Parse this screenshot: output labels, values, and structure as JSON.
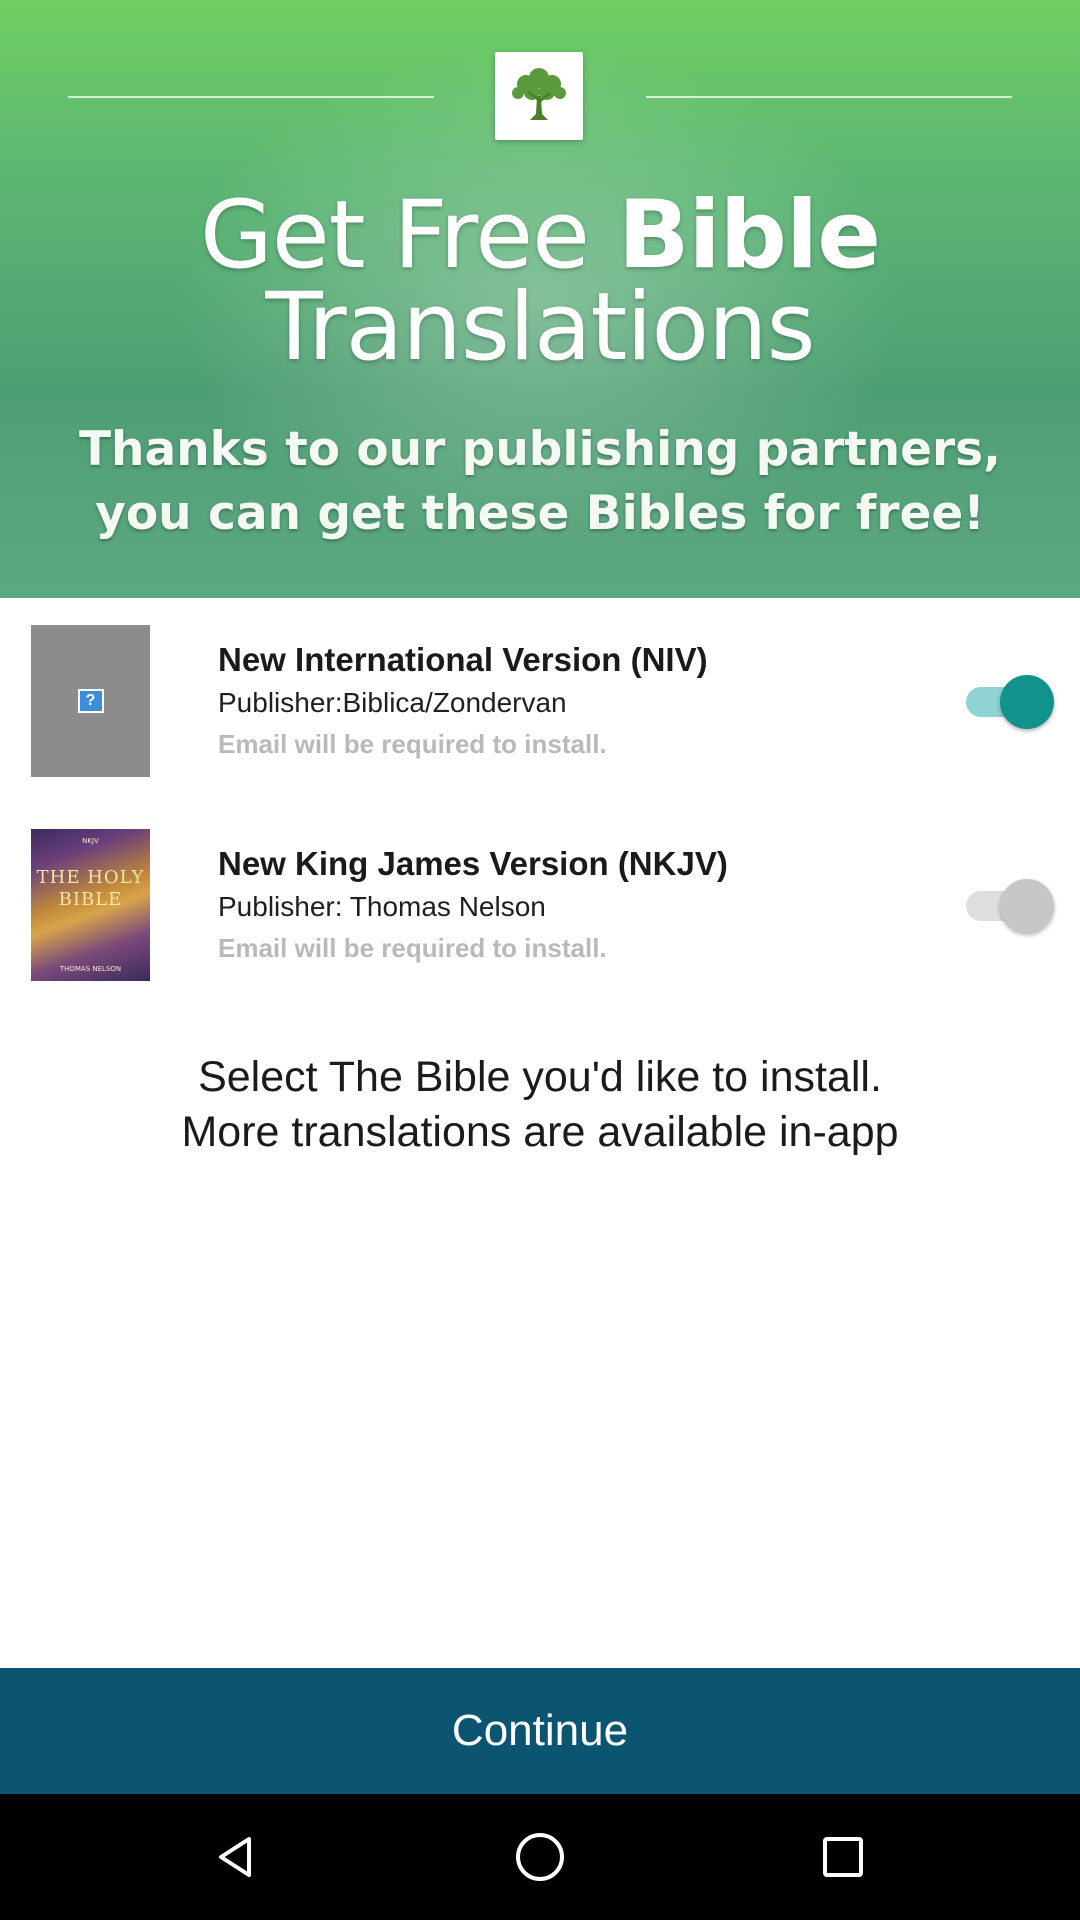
{
  "hero": {
    "title_light": "Get Free",
    "title_bold": "Bible",
    "title_line2": "Translations",
    "subtitle_line1": "Thanks to our publishing partners,",
    "subtitle_line2": "you can get these Bibles for free!",
    "logo_icon": "tree-icon"
  },
  "translations": [
    {
      "title": "New International Version (NIV)",
      "publisher": "Publisher:Biblica/Zondervan",
      "note": "Email will be required to install.",
      "cover": "placeholder-image",
      "enabled": true
    },
    {
      "title": "New King James Version (NKJV)",
      "publisher": "Publisher: Thomas Nelson",
      "note": "Email will be required to install.",
      "cover_text": "THE HOLY BIBLE",
      "enabled": false
    }
  ],
  "hint": {
    "line1": "Select The Bible you'd like to install.",
    "line2": "More translations are available in-app"
  },
  "continue_label": "Continue",
  "colors": {
    "accent": "#11938c",
    "button": "#0c5571",
    "hero_green": "#5cb673"
  },
  "navbar": {
    "back_icon": "back-icon",
    "home_icon": "home-icon",
    "recents_icon": "recents-icon"
  }
}
